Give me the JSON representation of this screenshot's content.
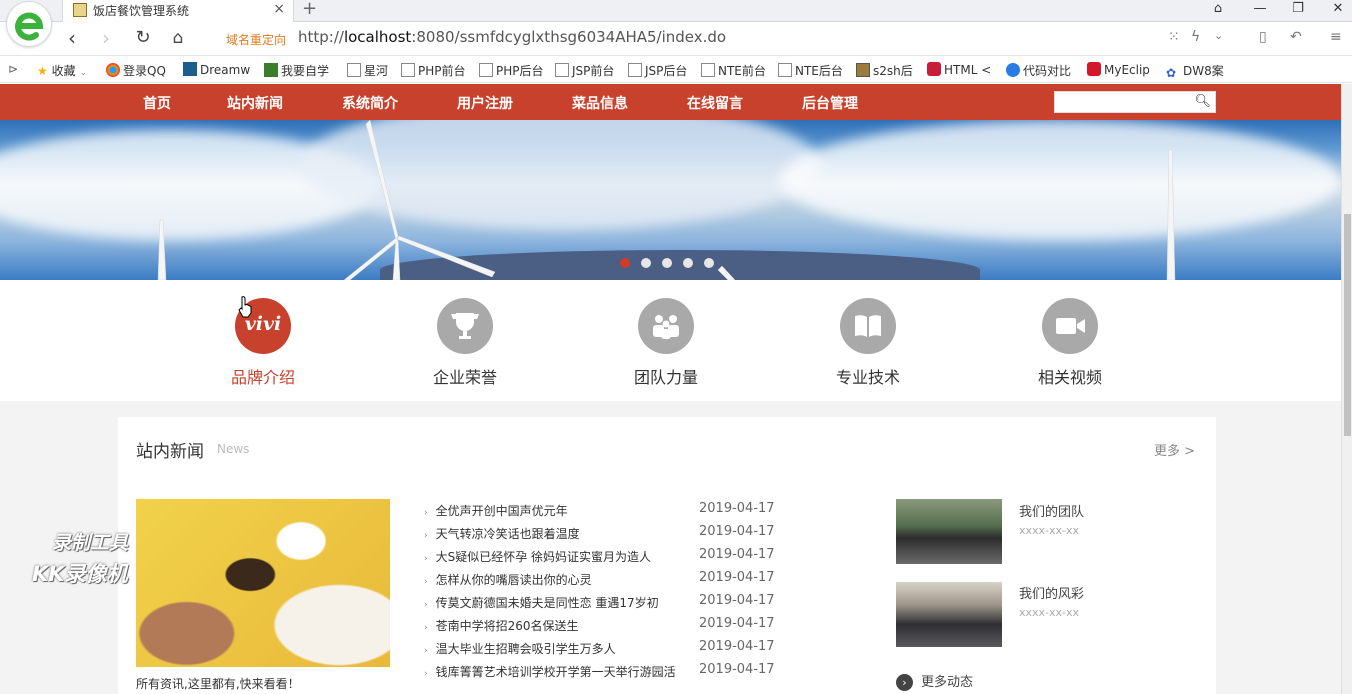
{
  "tab": {
    "title": "饭店餐饮管理系统",
    "close": "×",
    "new_tab": "+"
  },
  "window": {
    "minimize": "—",
    "maximize": "❐",
    "close": "✕"
  },
  "address": {
    "redirect_label": "域名重定向",
    "url_prefix": "http://",
    "url_host": "localhost",
    "url_rest": ":8080/ssmfdcyglxthsg6034AHA5/index.do"
  },
  "bookmarks": [
    {
      "label": "收藏",
      "icon": "star-icon"
    },
    {
      "label": "登录QQ",
      "icon": "qq-icon"
    },
    {
      "label": "Dreamw",
      "icon": "dreamweaver-icon"
    },
    {
      "label": "我要自学",
      "icon": "book-icon"
    },
    {
      "label": "星河",
      "icon": "page-icon"
    },
    {
      "label": "PHP前台",
      "icon": "page-icon"
    },
    {
      "label": "PHP后台",
      "icon": "page-icon"
    },
    {
      "label": "JSP前台",
      "icon": "page-icon"
    },
    {
      "label": "JSP后台",
      "icon": "page-icon"
    },
    {
      "label": "NTE前台",
      "icon": "page-icon"
    },
    {
      "label": "NTE后台",
      "icon": "page-icon"
    },
    {
      "label": "s2sh后",
      "icon": "picture-icon"
    },
    {
      "label": "HTML <",
      "icon": "html-icon"
    },
    {
      "label": "代码对比",
      "icon": "compare-icon"
    },
    {
      "label": "MyEclip",
      "icon": "myeclipse-icon"
    },
    {
      "label": "DW8案",
      "icon": "paw-icon"
    }
  ],
  "nav": {
    "items": [
      "首页",
      "站内新闻",
      "系统简介",
      "用户注册",
      "菜品信息",
      "在线留言",
      "后台管理"
    ],
    "search_placeholder": ""
  },
  "banner": {
    "slide_count": 5,
    "active_slide": 1
  },
  "features": [
    {
      "label": "品牌介绍",
      "icon": "vivi-brand-icon",
      "active": true,
      "icon_text": "vivi"
    },
    {
      "label": "企业荣誉",
      "icon": "trophy-icon",
      "active": false
    },
    {
      "label": "团队力量",
      "icon": "team-icon",
      "active": false
    },
    {
      "label": "专业技术",
      "icon": "open-book-icon",
      "active": false
    },
    {
      "label": "相关视频",
      "icon": "video-camera-icon",
      "active": false
    }
  ],
  "news": {
    "title": "站内新闻",
    "subtitle": "News",
    "more": "更多 >",
    "caption": "所有资讯,这里都有,快来看看！",
    "items": [
      {
        "title": "全优声开创中国声优元年",
        "date": "2019-04-17"
      },
      {
        "title": "天气转凉冷笑话也跟着温度",
        "date": "2019-04-17"
      },
      {
        "title": "大S疑似已经怀孕 徐妈妈证实蜜月为造人",
        "date": "2019-04-17"
      },
      {
        "title": "怎样从你的嘴唇读出你的心灵",
        "date": "2019-04-17"
      },
      {
        "title": "传莫文蔚德国未婚夫是同性恋 重遇17岁初",
        "date": "2019-04-17"
      },
      {
        "title": "苍南中学将招260名保送生",
        "date": "2019-04-17"
      },
      {
        "title": "温大毕业生招聘会吸引学生万多人",
        "date": "2019-04-17"
      },
      {
        "title": "钱库箐箐艺术培训学校开学第一天举行游园活",
        "date": "2019-04-17"
      }
    ],
    "team": [
      {
        "title": "我们的团队",
        "date": "xxxx-xx-xx"
      },
      {
        "title": "我们的风彩",
        "date": "xxxx-xx-xx"
      }
    ],
    "more_dynamic": "更多动态"
  },
  "watermark": {
    "line1": "录制工具",
    "line2": "KK录像机"
  },
  "colors": {
    "brand": "#c8412d",
    "active_dot": "#d23a2a",
    "redirect": "#e07b22"
  }
}
